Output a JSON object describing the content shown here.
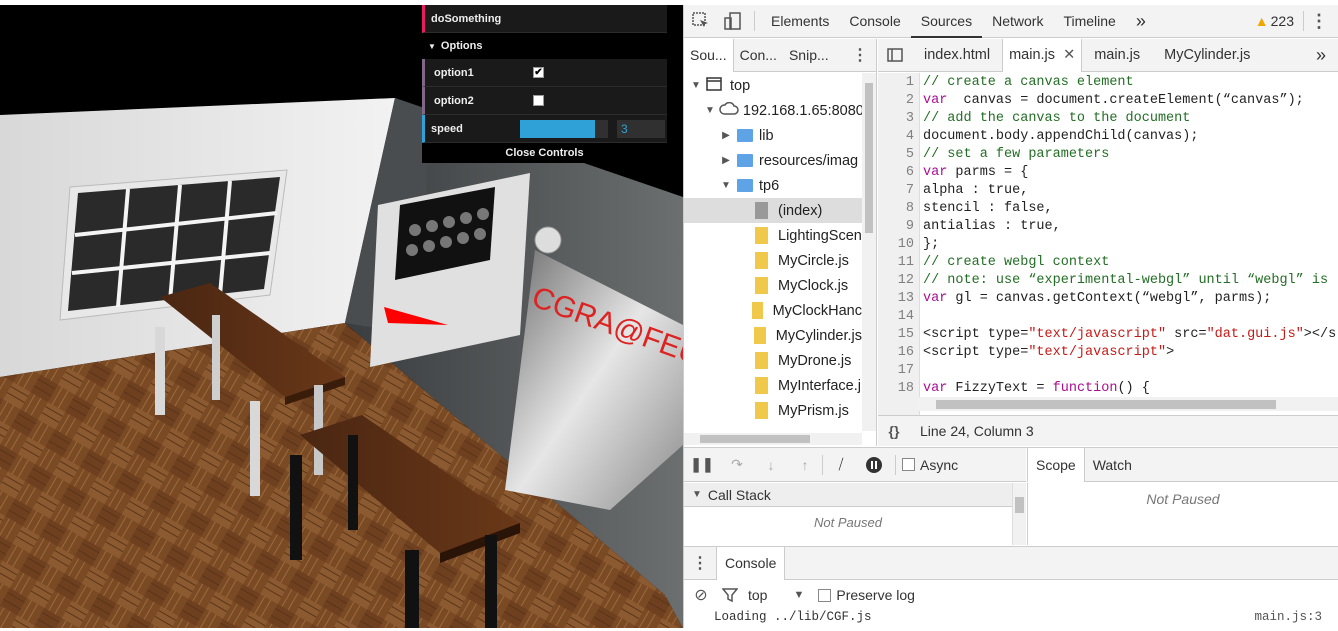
{
  "gui": {
    "fn_label": "doSomething",
    "folder_label": "Options",
    "option1_label": "option1",
    "option1_checked": true,
    "option2_label": "option2",
    "option2_checked": false,
    "speed_label": "speed",
    "speed_value": "3",
    "speed_fill_fraction": 0.85,
    "close_label": "Close Controls"
  },
  "scene": {
    "board_text": "CGRA@FEUP"
  },
  "devtools": {
    "tabs": [
      "Elements",
      "Console",
      "Sources",
      "Network",
      "Timeline"
    ],
    "more": "»",
    "warn_count": "223",
    "nav_tabs": [
      "Sou...",
      "Con...",
      "Snip..."
    ],
    "tree": [
      {
        "label": "top",
        "type": "frame",
        "depth": 0,
        "arrow": "▼"
      },
      {
        "label": "192.168.1.65:8080",
        "type": "cloud",
        "depth": 1,
        "arrow": "▼"
      },
      {
        "label": "lib",
        "type": "folder",
        "depth": 2,
        "arrow": "▶"
      },
      {
        "label": "resources/imag",
        "type": "folder",
        "depth": 2,
        "arrow": "▶"
      },
      {
        "label": "tp6",
        "type": "folder",
        "depth": 2,
        "arrow": "▼"
      },
      {
        "label": "(index)",
        "type": "file-gray",
        "depth": 3,
        "arrow": "",
        "selected": true
      },
      {
        "label": "LightingScen",
        "type": "file",
        "depth": 3,
        "arrow": ""
      },
      {
        "label": "MyCircle.js",
        "type": "file",
        "depth": 3,
        "arrow": ""
      },
      {
        "label": "MyClock.js",
        "type": "file",
        "depth": 3,
        "arrow": ""
      },
      {
        "label": "MyClockHanc",
        "type": "file",
        "depth": 3,
        "arrow": ""
      },
      {
        "label": "MyCylinder.js",
        "type": "file",
        "depth": 3,
        "arrow": ""
      },
      {
        "label": "MyDrone.js",
        "type": "file",
        "depth": 3,
        "arrow": ""
      },
      {
        "label": "MyInterface.j",
        "type": "file",
        "depth": 3,
        "arrow": ""
      },
      {
        "label": "MyPrism.js",
        "type": "file",
        "depth": 3,
        "arrow": ""
      }
    ],
    "editor_tabs": [
      {
        "label": "index.html",
        "active": false
      },
      {
        "label": "main.js",
        "active": true,
        "closable": true
      },
      {
        "label": "main.js",
        "active": false
      },
      {
        "label": "MyCylinder.js",
        "active": false
      }
    ],
    "code": [
      [
        [
          "cm",
          "// create a canvas element"
        ]
      ],
      [
        [
          "kw",
          "var"
        ],
        [
          "",
          "  canvas = document.createElement(“canvas”);"
        ]
      ],
      [
        [
          "cm",
          "// add the canvas to the document"
        ]
      ],
      [
        [
          "",
          "document.body.appendChild(canvas);"
        ]
      ],
      [
        [
          "cm",
          "// set a few parameters"
        ]
      ],
      [
        [
          "kw",
          "var"
        ],
        [
          "",
          " parms = {"
        ]
      ],
      [
        [
          "",
          "alpha : true,"
        ]
      ],
      [
        [
          "",
          "stencil : false,"
        ]
      ],
      [
        [
          "",
          "antialias : true,"
        ]
      ],
      [
        [
          "",
          "};"
        ]
      ],
      [
        [
          "cm",
          "// create webgl context"
        ]
      ],
      [
        [
          "cm",
          "// note: use “experimental-webgl” until “webgl” is"
        ]
      ],
      [
        [
          "kw",
          "var"
        ],
        [
          "",
          " gl = canvas.getContext(“webgl”, parms);"
        ]
      ],
      [
        [
          "",
          ""
        ]
      ],
      [
        [
          "",
          "<script type="
        ],
        [
          "st",
          "\"text/javascript\""
        ],
        [
          "",
          " src="
        ],
        [
          "st",
          "\"dat.gui.js\""
        ],
        [
          "",
          "></s"
        ]
      ],
      [
        [
          "",
          "<script type="
        ],
        [
          "st",
          "\"text/javascript\""
        ],
        [
          "",
          ">"
        ]
      ],
      [
        [
          "",
          ""
        ]
      ],
      [
        [
          "kw",
          "var"
        ],
        [
          "",
          " FizzyText = "
        ],
        [
          "kw",
          "function"
        ],
        [
          "",
          "() {"
        ]
      ]
    ],
    "status": "Line 24, Column 3",
    "async_label": "Async",
    "scope_tabs": [
      "Scope",
      "Watch"
    ],
    "not_paused": "Not Paused",
    "call_stack": "Call Stack",
    "console_tab": "Console",
    "console_context": "top",
    "preserve_log": "Preserve log",
    "log_line": "Loading ../lib/CGF.js",
    "log_source": "main.js:3"
  }
}
